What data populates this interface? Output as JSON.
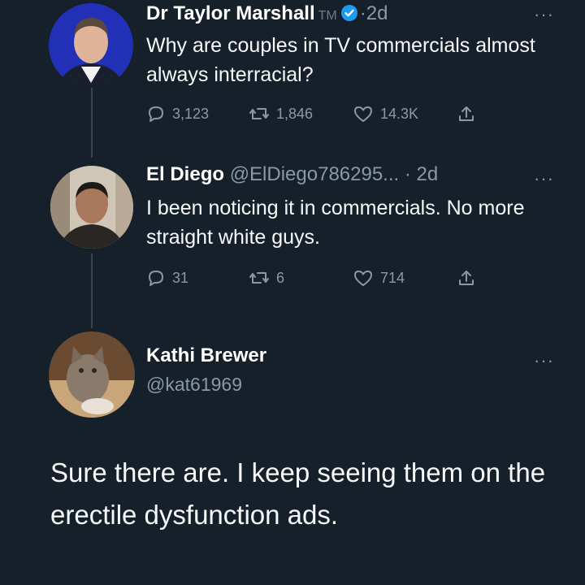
{
  "tweets": [
    {
      "name": "Dr Taylor Marshall",
      "badge_text": "TM",
      "verified": true,
      "separator": "·",
      "time": "2d",
      "text": "Why are couples in TV commercials almost always interracial?",
      "replies": "3,123",
      "retweets": "1,846",
      "likes": "14.3K",
      "more": "···"
    },
    {
      "name": "El Diego",
      "handle": "@ElDiego786295...",
      "separator": "·",
      "time": "2d",
      "text": "I been noticing it in commercials. No more straight white guys.",
      "replies": "31",
      "retweets": "6",
      "likes": "714",
      "more": "···"
    }
  ],
  "reply": {
    "name": "Kathi Brewer",
    "handle": "@kat61969",
    "text": "Sure there are. I keep seeing them on the erectile dysfunction ads.",
    "more": "···"
  },
  "icons": [
    "reply-icon",
    "retweet-icon",
    "like-icon",
    "share-icon",
    "verified-icon",
    "more-icon"
  ],
  "colors": {
    "background": "#15202b",
    "secondary_text": "#8b98a5",
    "verified_blue": "#1d9bf0",
    "thread_line": "#38444d"
  }
}
